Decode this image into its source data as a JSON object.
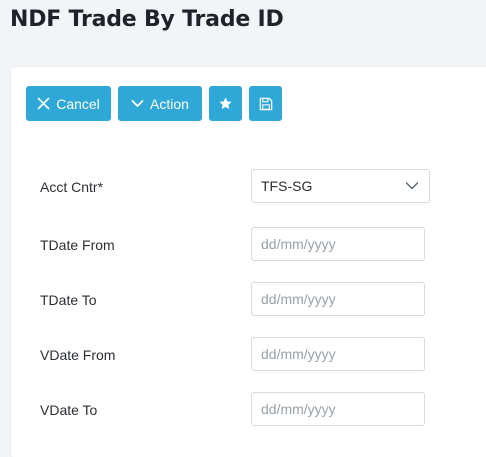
{
  "page": {
    "title": "NDF Trade By Trade ID"
  },
  "toolbar": {
    "cancel_label": "Cancel",
    "action_label": "Action",
    "favorite_icon": "star-icon",
    "save_icon": "save-icon"
  },
  "form": {
    "acct_cntr": {
      "label": "Acct Cntr*",
      "value": "TFS-SG"
    },
    "tdate_from": {
      "label": "TDate From",
      "placeholder": "dd/mm/yyyy"
    },
    "tdate_to": {
      "label": "TDate To",
      "placeholder": "dd/mm/yyyy"
    },
    "vdate_from": {
      "label": "VDate From",
      "placeholder": "dd/mm/yyyy"
    },
    "vdate_to": {
      "label": "VDate To",
      "placeholder": "dd/mm/yyyy"
    }
  },
  "colors": {
    "accent": "#2fa8d8",
    "background": "#f2f4f8",
    "card": "#ffffff",
    "border": "#d6dbe0"
  }
}
